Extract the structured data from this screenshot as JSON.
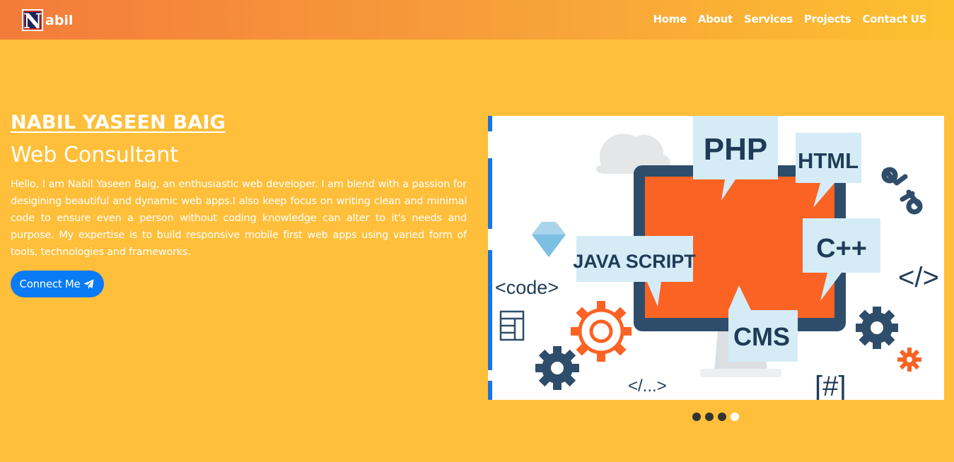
{
  "navbar": {
    "brand_initial": "N",
    "brand_rest": "abil",
    "links": [
      "Home",
      "About",
      "Services",
      "Projects",
      "Contact US"
    ]
  },
  "hero": {
    "name": "NABIL YASEEN BAIG",
    "role": "Web Consultant",
    "bio": "Hello, I am Nabil Yaseen Baig, an enthusiastic web developer. I am blend with a passion for desigining beautiful and dynamic web apps.I also keep focus on writing clean and minimal code to ensure even a person without coding knowledge can alter to it's needs and purpose. My expertise is to build responsive mobile first web apps using varied form of tools, technologies and frameworks.",
    "button_label": "Connect Me",
    "button_icon": "paper-plane-icon"
  },
  "carousel": {
    "slide_labels": [
      "PHP",
      "HTML",
      "C++",
      "JAVA SCRIPT",
      "CMS",
      "<code>",
      "</>",
      "</...>",
      "[#]"
    ],
    "dot_count": 4,
    "active_dot": 4
  },
  "colors": {
    "background": "#ffbf3a",
    "nav_gradient_start": "#f47b3a",
    "nav_gradient_end": "#fdc12f",
    "button": "#0a7bf5",
    "monitor_screen": "#fa6323",
    "bubble": "#d5ecf7",
    "text_dark": "#1f3b57"
  }
}
